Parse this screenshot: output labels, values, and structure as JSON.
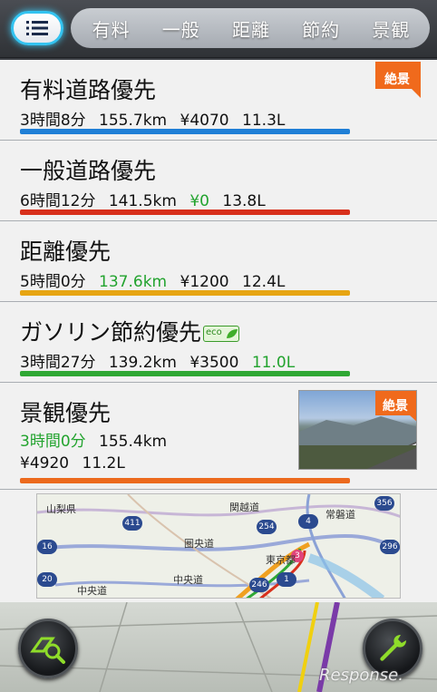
{
  "tabs": {
    "items": [
      {
        "label": "有料"
      },
      {
        "label": "一般"
      },
      {
        "label": "距離"
      },
      {
        "label": "節約"
      },
      {
        "label": "景観"
      }
    ]
  },
  "routes": [
    {
      "name": "有料道路優先",
      "time": "3時間8分",
      "distance": "155.7km",
      "toll": "¥4070",
      "fuel": "11.3L",
      "badge": "絶景",
      "bar_color": "#1f7fd6"
    },
    {
      "name": "一般道路優先",
      "time": "6時間12分",
      "distance": "141.5km",
      "toll": "¥0",
      "fuel": "13.8L",
      "bar_color": "#d8301c"
    },
    {
      "name": "距離優先",
      "time": "5時間0分",
      "distance": "137.6km",
      "toll": "¥1200",
      "fuel": "12.4L",
      "bar_color": "#e7a512"
    },
    {
      "name": "ガソリン節約優先",
      "eco_label": "eco",
      "time": "3時間27分",
      "distance": "139.2km",
      "toll": "¥3500",
      "fuel": "11.0L",
      "bar_color": "#2fa834"
    },
    {
      "name": "景観優先",
      "time": "3時間0分",
      "distance": "155.4km",
      "toll": "¥4920",
      "fuel": "11.2L",
      "badge": "絶景",
      "bar_color": "#ec6a1e"
    }
  ],
  "map": {
    "labels": [
      "山梨県",
      "関越道",
      "常磐道",
      "圏央道",
      "東京都",
      "中央道",
      "中央道"
    ],
    "route_numbers": [
      "411",
      "254",
      "4",
      "356",
      "16",
      "296",
      "20",
      "246",
      "1",
      "3"
    ]
  },
  "watermark": "Response."
}
